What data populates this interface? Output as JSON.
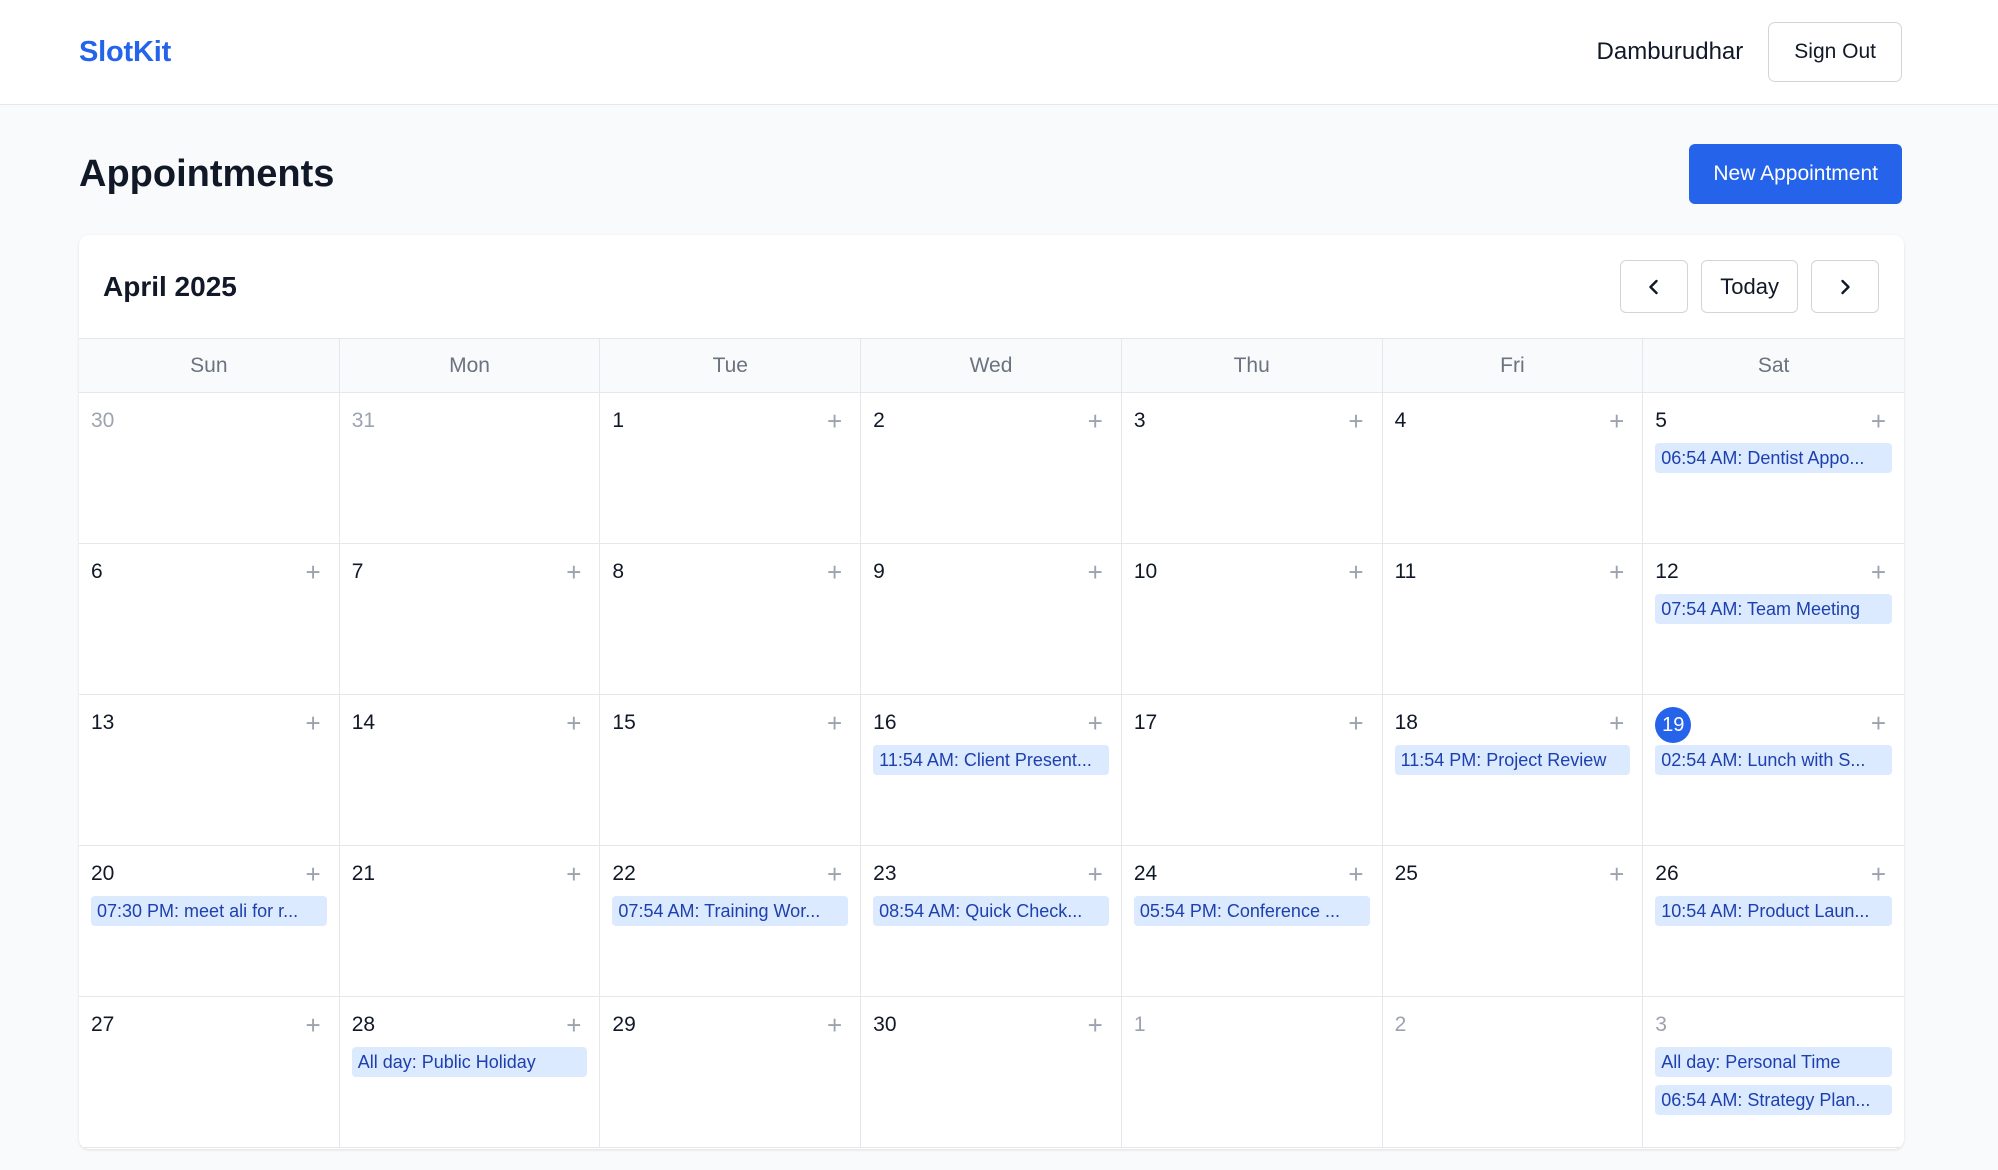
{
  "app": {
    "brand": "SlotKit",
    "username": "Damburudhar",
    "signout_label": "Sign Out"
  },
  "page": {
    "title": "Appointments",
    "new_button_label": "New Appointment"
  },
  "calendar": {
    "month_label": "April 2025",
    "prev_icon": "chevron-left-icon",
    "next_icon": "chevron-right-icon",
    "today_label": "Today",
    "add_icon_glyph": "+",
    "weekdays": [
      "Sun",
      "Mon",
      "Tue",
      "Wed",
      "Thu",
      "Fri",
      "Sat"
    ],
    "today_day": "19",
    "accent_color": "#2563eb",
    "event_bg_color": "#dbeafe",
    "event_text_color": "#1e40af",
    "days": [
      {
        "day": "30",
        "muted": true,
        "events": []
      },
      {
        "day": "31",
        "muted": true,
        "events": []
      },
      {
        "day": "1",
        "muted": false,
        "events": []
      },
      {
        "day": "2",
        "muted": false,
        "events": []
      },
      {
        "day": "3",
        "muted": false,
        "events": []
      },
      {
        "day": "4",
        "muted": false,
        "events": []
      },
      {
        "day": "5",
        "muted": false,
        "events": [
          "06:54 AM: Dentist Appo..."
        ]
      },
      {
        "day": "6",
        "muted": false,
        "events": []
      },
      {
        "day": "7",
        "muted": false,
        "events": []
      },
      {
        "day": "8",
        "muted": false,
        "events": []
      },
      {
        "day": "9",
        "muted": false,
        "events": []
      },
      {
        "day": "10",
        "muted": false,
        "events": []
      },
      {
        "day": "11",
        "muted": false,
        "events": []
      },
      {
        "day": "12",
        "muted": false,
        "events": [
          "07:54 AM: Team Meeting"
        ]
      },
      {
        "day": "13",
        "muted": false,
        "events": []
      },
      {
        "day": "14",
        "muted": false,
        "events": []
      },
      {
        "day": "15",
        "muted": false,
        "events": []
      },
      {
        "day": "16",
        "muted": false,
        "events": [
          "11:54 AM: Client Present..."
        ]
      },
      {
        "day": "17",
        "muted": false,
        "events": []
      },
      {
        "day": "18",
        "muted": false,
        "events": [
          "11:54 PM: Project Review"
        ]
      },
      {
        "day": "19",
        "muted": false,
        "today": true,
        "events": [
          "02:54 AM: Lunch with S..."
        ]
      },
      {
        "day": "20",
        "muted": false,
        "events": [
          "07:30 PM: meet ali for r..."
        ]
      },
      {
        "day": "21",
        "muted": false,
        "events": []
      },
      {
        "day": "22",
        "muted": false,
        "events": [
          "07:54 AM: Training Wor..."
        ]
      },
      {
        "day": "23",
        "muted": false,
        "events": [
          "08:54 AM: Quick Check..."
        ]
      },
      {
        "day": "24",
        "muted": false,
        "events": [
          "05:54 PM: Conference ..."
        ]
      },
      {
        "day": "25",
        "muted": false,
        "events": []
      },
      {
        "day": "26",
        "muted": false,
        "events": [
          "10:54 AM: Product Laun..."
        ]
      },
      {
        "day": "27",
        "muted": false,
        "events": []
      },
      {
        "day": "28",
        "muted": false,
        "events": [
          "All day: Public Holiday"
        ]
      },
      {
        "day": "29",
        "muted": false,
        "events": []
      },
      {
        "day": "30",
        "muted": false,
        "events": []
      },
      {
        "day": "1",
        "muted": true,
        "events": []
      },
      {
        "day": "2",
        "muted": true,
        "events": []
      },
      {
        "day": "3",
        "muted": true,
        "events": [
          "All day: Personal Time",
          "06:54 AM: Strategy Plan..."
        ]
      }
    ]
  }
}
